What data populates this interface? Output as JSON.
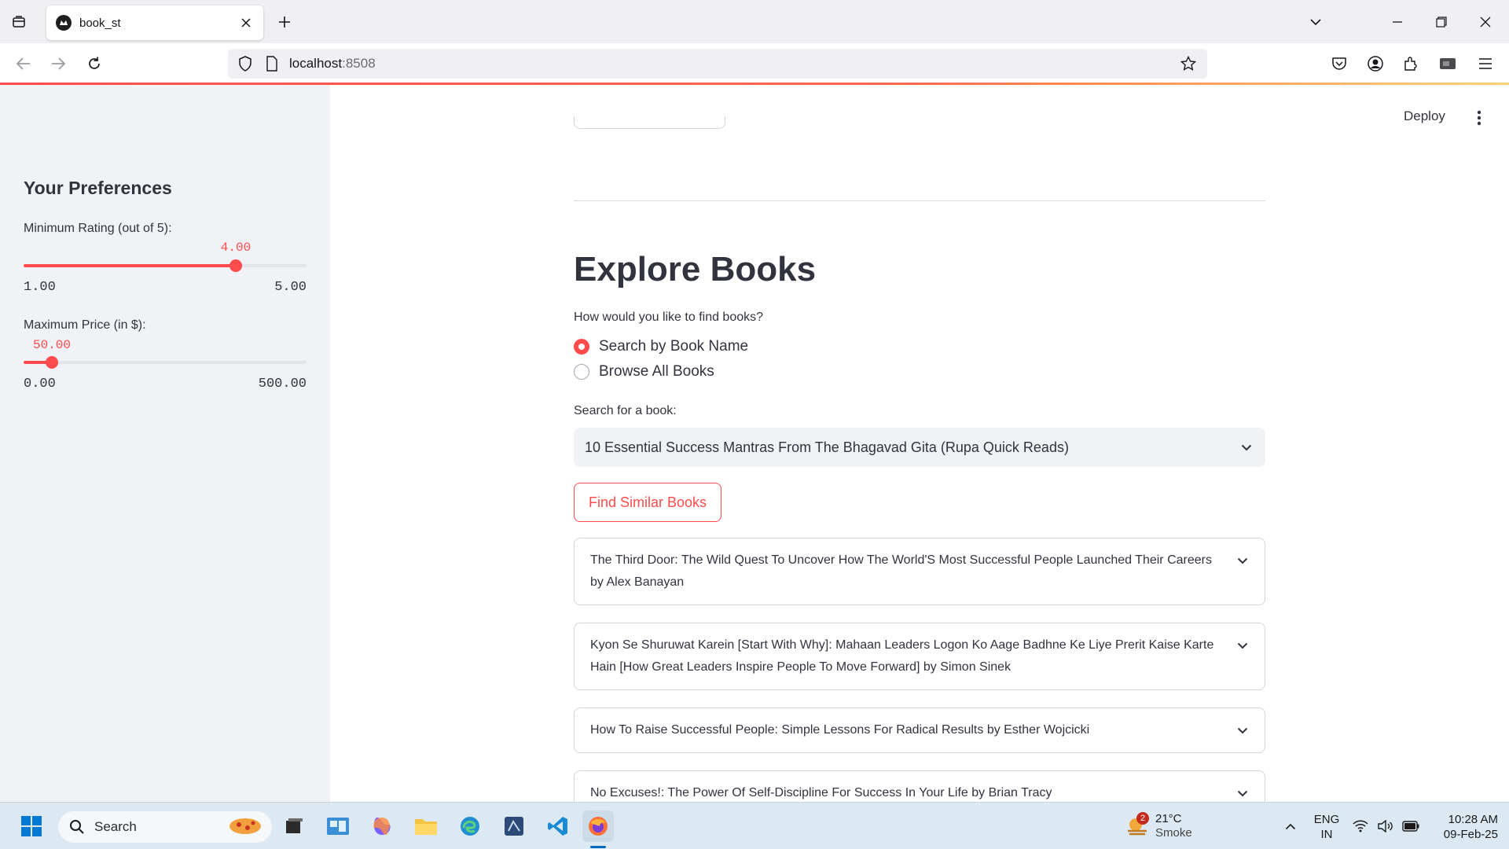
{
  "browser": {
    "tab_title": "book_st",
    "url_host": "localhost",
    "url_port": ":8508"
  },
  "sidebar": {
    "heading": "Your Preferences",
    "rating_slider": {
      "label": "Minimum Rating (out of 5):",
      "value_text": "4.00",
      "value": 4.0,
      "min_text": "1.00",
      "max_text": "5.00",
      "min": 1.0,
      "max": 5.0
    },
    "price_slider": {
      "label": "Maximum Price (in $):",
      "value_text": "50.00",
      "value": 50.0,
      "min_text": "0.00",
      "max_text": "500.00",
      "min": 0.0,
      "max": 500.0
    }
  },
  "header": {
    "deploy_label": "Deploy"
  },
  "main": {
    "title": "Explore Books",
    "question": "How would you like to find books?",
    "radio_options": [
      {
        "label": "Search by Book Name",
        "checked": true
      },
      {
        "label": "Browse All Books",
        "checked": false
      }
    ],
    "search_label": "Search for a book:",
    "selected_book": "10 Essential Success Mantras From The Bhagavad Gita (Rupa Quick Reads)",
    "find_button": "Find Similar Books",
    "results": [
      "The Third Door: The Wild Quest To Uncover How The World'S Most Successful People Launched Their Careers by Alex Banayan",
      "Kyon Se Shuruwat Karein [Start With Why]: Mahaan Leaders Logon Ko Aage Badhne Ke Liye Prerit Kaise Karte Hain [How Great Leaders Inspire People To Move Forward] by Simon Sinek",
      "How To Raise Successful People: Simple Lessons For Radical Results by Esther Wojcicki",
      "No Excuses!: The Power Of Self-Discipline For Success In Your Life by Brian Tracy"
    ]
  },
  "taskbar": {
    "search_placeholder": "Search",
    "weather_badge": "2",
    "weather_temp": "21°C",
    "weather_cond": "Smoke",
    "lang_line1": "ENG",
    "lang_line2": "IN",
    "time": "10:28 AM",
    "date": "09-Feb-25"
  },
  "colors": {
    "accent": "#ff4b4b",
    "sidebar_bg": "#f0f2f6"
  }
}
